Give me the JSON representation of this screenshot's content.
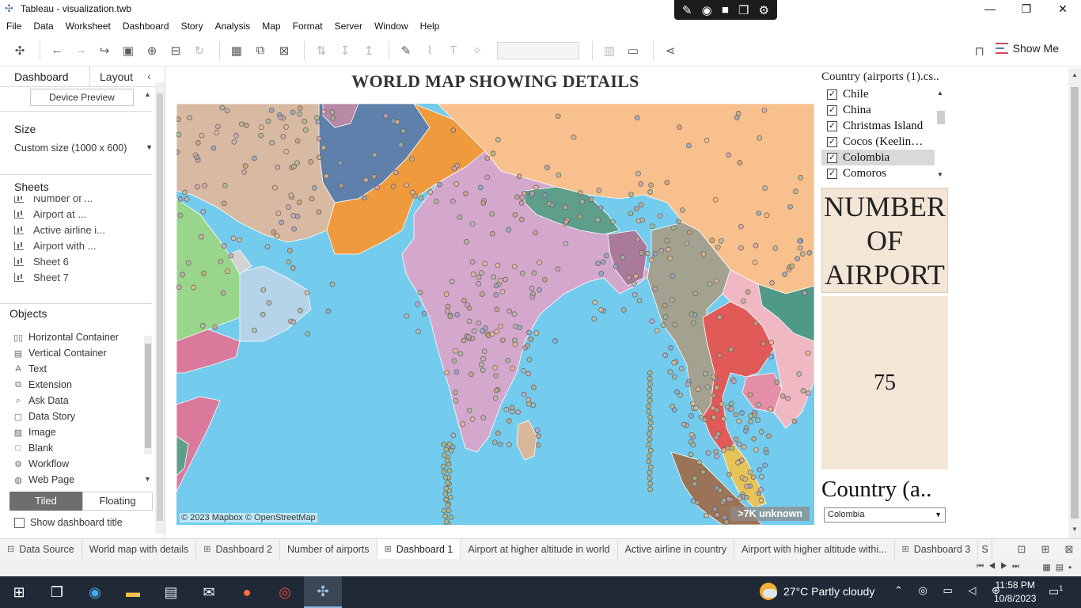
{
  "window": {
    "title": "Tableau - visualization.twb",
    "controls": [
      "—",
      "❐",
      "✕"
    ]
  },
  "menu": [
    "File",
    "Data",
    "Worksheet",
    "Dashboard",
    "Story",
    "Analysis",
    "Map",
    "Format",
    "Server",
    "Window",
    "Help"
  ],
  "toolbar": {
    "show_me_label": "Show Me"
  },
  "left_pane": {
    "tabs": {
      "dashboard": "Dashboard",
      "layout": "Layout"
    },
    "device_preview": "Device Preview",
    "size_title": "Size",
    "size_value": "Custom size (1000 x 600)",
    "sheets_title": "Sheets",
    "sheets": [
      "Number of ...",
      "Airport at ...",
      "Active airline i...",
      "Airport with ...",
      "Sheet 6",
      "Sheet 7"
    ],
    "objects_title": "Objects",
    "objects": [
      {
        "label": "Horizontal Container",
        "icon": "horizontal-container-icon"
      },
      {
        "label": "Vertical Container",
        "icon": "vertical-container-icon"
      },
      {
        "label": "Text",
        "icon": "text-icon"
      },
      {
        "label": "Extension",
        "icon": "extension-icon"
      },
      {
        "label": "Ask Data",
        "icon": "ask-data-icon"
      },
      {
        "label": "Data Story",
        "icon": "data-story-icon"
      },
      {
        "label": "Image",
        "icon": "image-icon"
      },
      {
        "label": "Blank",
        "icon": "blank-icon"
      },
      {
        "label": "Workflow",
        "icon": "workflow-icon"
      },
      {
        "label": "Web Page",
        "icon": "web-page-icon"
      }
    ],
    "tiled": "Tiled",
    "floating": "Floating",
    "show_dashboard_title": "Show dashboard title"
  },
  "dashboard": {
    "title": "WORLD MAP SHOWING DETAILS",
    "map_attribution": "© 2023 Mapbox © OpenStreetMap",
    "unknown_badge": ">7K unknown"
  },
  "filter": {
    "title": "Country (airports (1).cs..",
    "items": [
      {
        "label": "Chile",
        "checked": true
      },
      {
        "label": "China",
        "checked": true
      },
      {
        "label": "Christmas Island",
        "checked": true
      },
      {
        "label": "Cocos (Keelin…",
        "checked": true
      },
      {
        "label": "Colombia",
        "checked": true,
        "selected": true
      },
      {
        "label": "Comoros",
        "checked": true
      }
    ]
  },
  "kpi": {
    "title": "NUMBER OF AIRPORT",
    "value": "75"
  },
  "country_param": {
    "title": "Country (a..",
    "selected": "Colombia"
  },
  "sheet_tabs": [
    {
      "label": "Data Source",
      "icon": "data-source-icon"
    },
    {
      "label": "World map with details"
    },
    {
      "label": "Dashboard 2",
      "icon": "dashboard-icon"
    },
    {
      "label": "Number of airports"
    },
    {
      "label": "Dashboard 1",
      "icon": "dashboard-icon",
      "active": true
    },
    {
      "label": "Airport at higher altitude in world"
    },
    {
      "label": "Active airline in country"
    },
    {
      "label": "Airport with higher altitude withi..."
    },
    {
      "label": "Dashboard 3",
      "icon": "dashboard-icon"
    },
    {
      "label": "S"
    }
  ],
  "taskbar": {
    "weather": "27°C  Partly cloudy",
    "time": "11:58 PM",
    "date": "10/8/2023",
    "notifications": "1"
  },
  "colors": {
    "sea": "#73cced",
    "kpi_bg": "#f4e6d6",
    "active_tab_bg": "#ffffff",
    "taskbar": "#202a36"
  }
}
